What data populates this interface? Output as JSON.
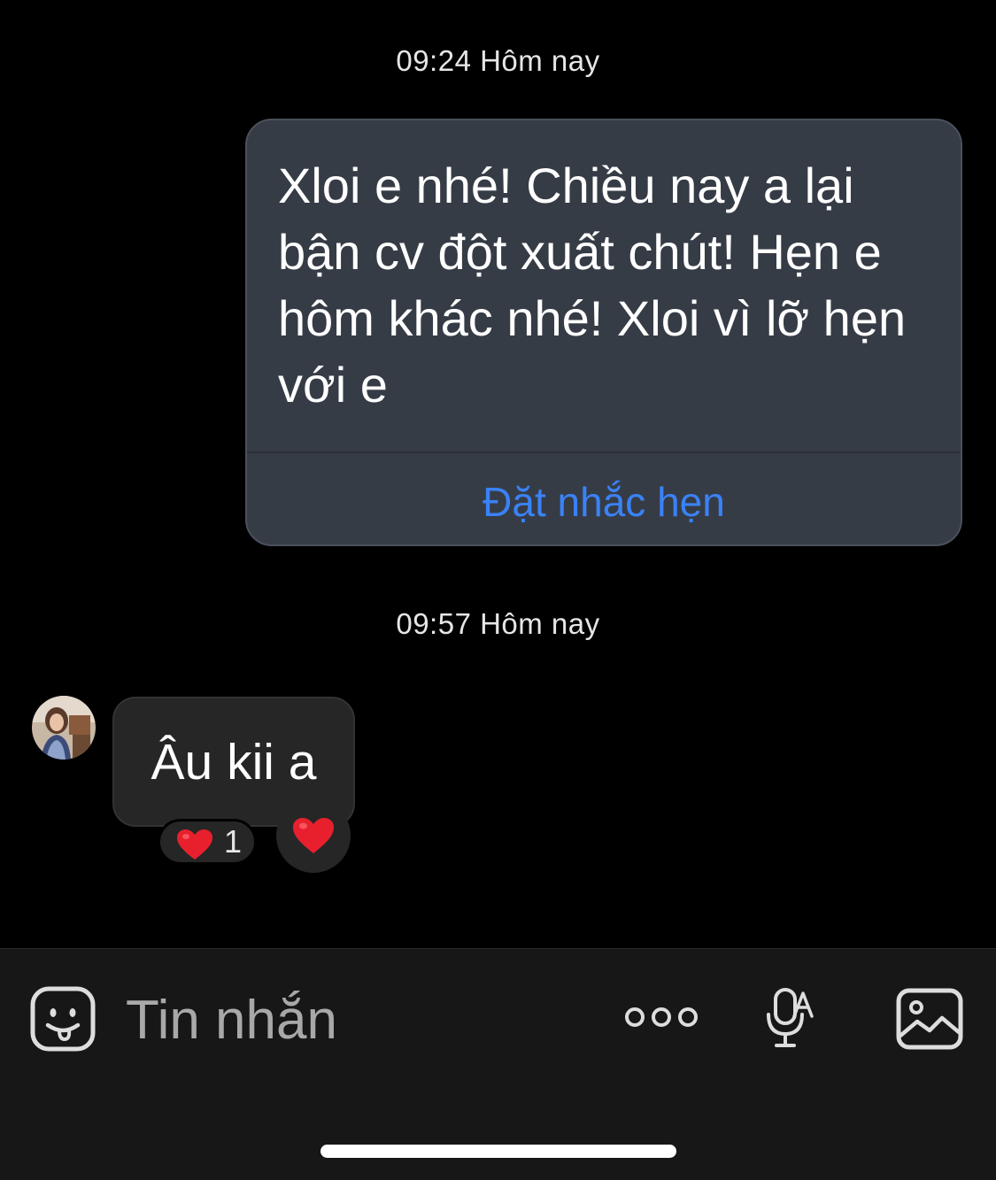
{
  "conversation": {
    "timestamps": [
      "09:24 Hôm nay",
      "09:57 Hôm nay"
    ],
    "sent_message": {
      "text": "Xloi e nhé! Chiều nay a lại bận cv đột xuất chút! Hẹn e hôm khác nhé! Xloi vì lỡ hẹn với e",
      "action_label": "Đặt nhắc hẹn"
    },
    "received_message": {
      "text": "Âu kii a",
      "reaction": {
        "emoji_icon": "heart-icon",
        "count": "1"
      }
    }
  },
  "composer": {
    "placeholder": "Tin nhắn",
    "icons": [
      "sticker-icon",
      "more-icon",
      "mic-icon",
      "image-icon"
    ]
  },
  "colors": {
    "background": "#000000",
    "sent_bubble": "#363c46",
    "received_bubble": "#262626",
    "action_link": "#3a82f7",
    "heart": "#e8202e",
    "composer_bar": "#171717"
  }
}
